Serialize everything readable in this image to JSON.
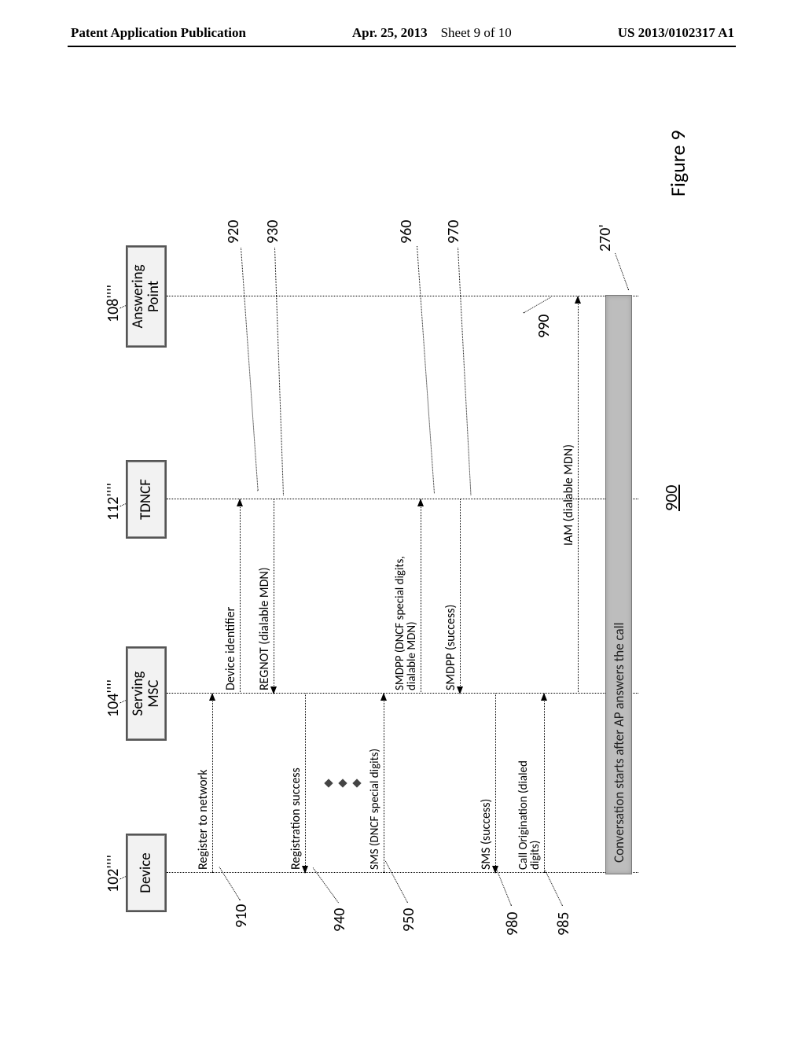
{
  "header": {
    "pub_label": "Patent Application Publication",
    "date": "Apr. 25, 2013",
    "sheet": "Sheet 9 of 10",
    "pub_number": "US 2013/0102317 A1"
  },
  "figure": {
    "caption": "Figure 9",
    "diagram_id": "900"
  },
  "actors": {
    "device": {
      "label": "Device",
      "ref": "102''''"
    },
    "msc": {
      "label": "Serving\nMSC",
      "ref": "104''''"
    },
    "tdncf": {
      "label": "TDNCF",
      "ref": "112''''"
    },
    "ap": {
      "label": "Answering\nPoint",
      "ref": "108''''"
    }
  },
  "messages": {
    "m910": {
      "text": "Register to network",
      "ref": "910"
    },
    "m920": {
      "text": "Device identifier",
      "ref": "920"
    },
    "m930": {
      "text": "REGNOT (dialable MDN)",
      "ref": "930"
    },
    "m940": {
      "text": "Registration success",
      "ref": "940"
    },
    "m950": {
      "text": "SMS (DNCF special digits)",
      "ref": "950"
    },
    "m960": {
      "text": "SMDPP (DNCF special digits,\ndialable MDN)",
      "ref": "960"
    },
    "m970": {
      "text": "SMDPP (success)",
      "ref": "970"
    },
    "m980": {
      "text": "SMS (success)",
      "ref": "980"
    },
    "m985": {
      "text": "Call Origination (dialed\ndigits)",
      "ref": "985"
    },
    "m990": {
      "text": "IAM (dialable MDN)",
      "ref": "990"
    }
  },
  "bar": {
    "text": "Conversation starts after AP answers the call",
    "ref": "270'"
  }
}
